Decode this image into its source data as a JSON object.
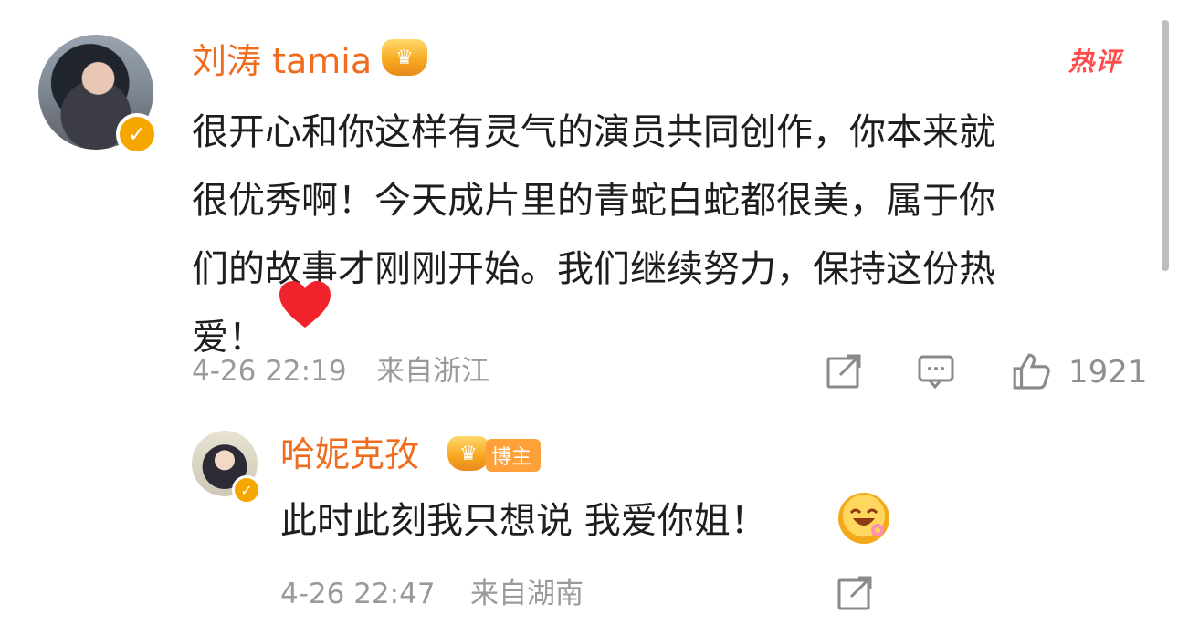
{
  "comment": {
    "username": "刘涛 tamia",
    "hot_label": "热评",
    "text": "很开心和你这样有灵气的演员共同创作，你本来就\n很优秀啊！今天成片里的青蛇白蛇都很美，属于你\n们的故事才刚刚开始。我们继续努力，保持这份热\n爱！",
    "time": "4-26 22:19",
    "location": "来自浙江",
    "likes": "1921",
    "icons": [
      "verified-badge-icon",
      "crown-icon",
      "heart-emoji-icon",
      "repost-icon",
      "comment-icon",
      "like-icon"
    ]
  },
  "reply": {
    "username": "哈妮克孜",
    "tag": "博主",
    "text": "此时此刻我只想说 我爱你姐！",
    "time": "4-26 22:47",
    "location": "来自湖南",
    "icons": [
      "verified-badge-icon",
      "crown-icon",
      "laughing-emoji-icon",
      "repost-icon"
    ]
  },
  "colors": {
    "accent_orange": "#f06c1f",
    "hot_red": "#ff4b4b",
    "meta_gray": "#9a9a9a"
  }
}
